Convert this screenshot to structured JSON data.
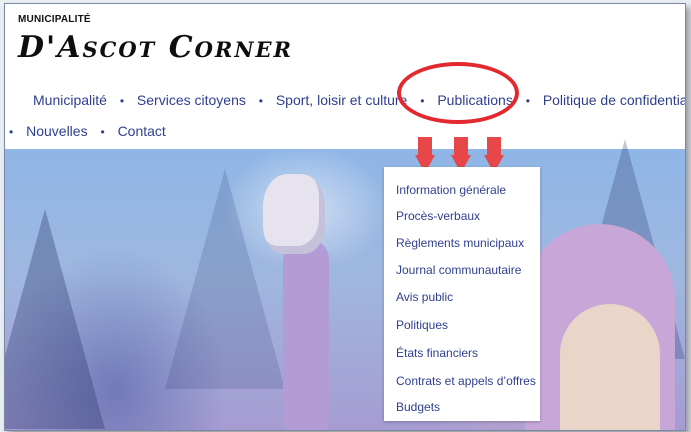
{
  "logo": {
    "small": "MUNICIPALITÉ",
    "big": "D'Ascot Corner"
  },
  "nav": {
    "row1": [
      "Municipalité",
      "Services citoyens",
      "Sport, loisir et culture",
      "Publications",
      "Politique de confidentialité"
    ],
    "row2": [
      "Nouvelles",
      "Contact"
    ]
  },
  "dropdown": {
    "items": [
      "Information générale",
      "Procès-verbaux",
      "Règlements municipaux",
      "Journal communautaire",
      "Avis public",
      "Politiques",
      "États financiers",
      "Contrats et appels d’offres",
      "Budgets"
    ]
  },
  "colors": {
    "nav_text": "#2f3f8f",
    "highlight": "#e3282e",
    "arrow": "#e8474a"
  },
  "icons": {
    "separator": "bullet",
    "annotation": "down-arrow"
  }
}
